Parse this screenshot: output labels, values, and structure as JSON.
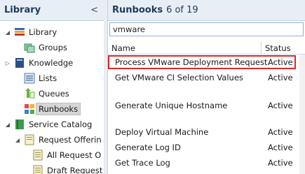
{
  "left_pane": {
    "title": "Library",
    "collapse_glyph": "<",
    "items": [
      {
        "label": "Library",
        "icon": "library-icon",
        "twisty": "◢"
      },
      {
        "label": "Groups",
        "icon": "groups-icon",
        "twisty": ""
      },
      {
        "label": "Knowledge",
        "icon": "knowledge-icon",
        "twisty": "▷"
      },
      {
        "label": "Lists",
        "icon": "lists-icon",
        "twisty": ""
      },
      {
        "label": "Queues",
        "icon": "queues-icon",
        "twisty": ""
      },
      {
        "label": "Runbooks",
        "icon": "runbooks-icon",
        "twisty": ""
      },
      {
        "label": "Service Catalog",
        "icon": "service-catalog-icon",
        "twisty": "◢"
      },
      {
        "label": "Request Offerin",
        "icon": "request-offering-icon",
        "twisty": "◢"
      },
      {
        "label": "All Request O",
        "icon": "document-icon",
        "twisty": ""
      },
      {
        "label": "Draft Request",
        "icon": "document-icon",
        "twisty": ""
      }
    ]
  },
  "right_pane": {
    "title": "Runbooks",
    "count": "6 of 19",
    "search_value": "vmware",
    "columns": {
      "name": "Name",
      "status": "Status"
    },
    "rows": [
      {
        "name": "Process VMware Deployment Request",
        "status": "Active"
      },
      {
        "name": "Get VMware CI Selection Values",
        "status": "Active"
      },
      {
        "name": "Generate Unique Hostname",
        "status": "Active"
      },
      {
        "name": "Deploy Virtual Machine",
        "status": "Active"
      },
      {
        "name": "Generate Log ID",
        "status": "Active"
      },
      {
        "name": "Get Trace Log",
        "status": "Active"
      }
    ]
  },
  "colors": {
    "highlight_border": "#d9282a",
    "header_bg": "#e8eef5",
    "title_text": "#1f3a5c"
  }
}
